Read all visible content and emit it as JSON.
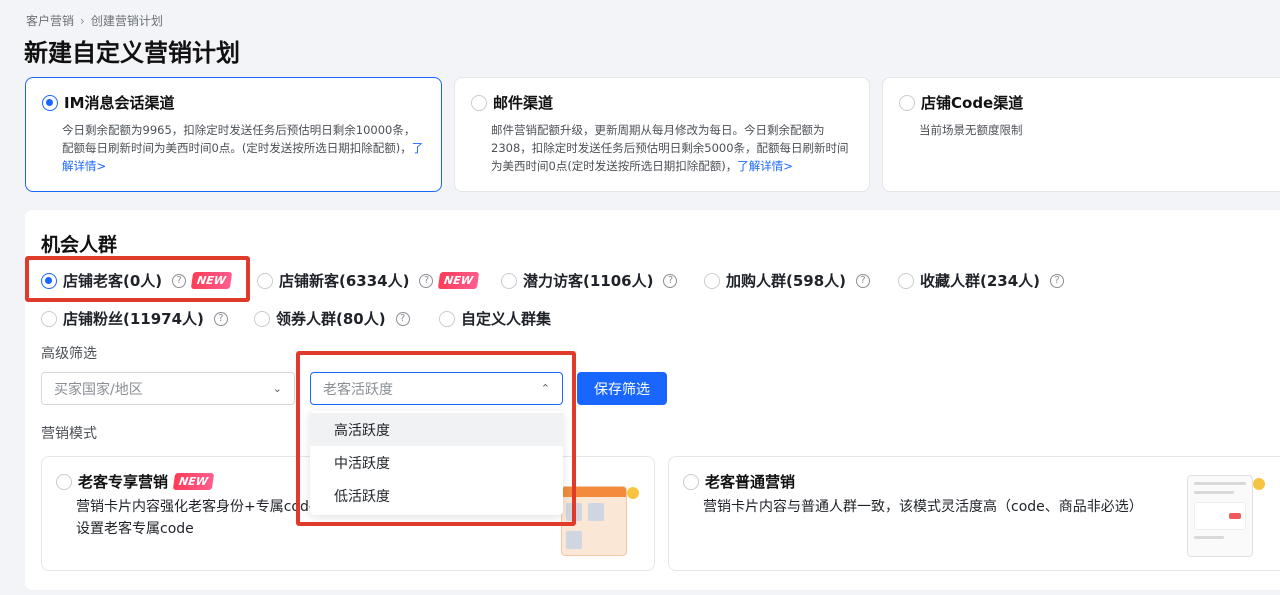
{
  "breadcrumb": {
    "root": "客户营销",
    "current": "创建营销计划"
  },
  "page_title": "新建自定义营销计划",
  "channels": [
    {
      "title": "IM消息会话渠道",
      "desc": "今日剩余配额为9965，扣除定时发送任务后预估明日剩余10000条，配额每日刷新时间为美西时间0点。(定时发送按所选日期扣除配额)，",
      "link": "了解详情>",
      "selected": true
    },
    {
      "title": "邮件渠道",
      "desc": "邮件营销配额升级，更新周期从每月修改为每日。今日剩余配额为2308，扣除定时发送任务后预估明日剩余5000条，配额每日刷新时间为美西时间0点(定时发送按所选日期扣除配额)，",
      "link": "了解详情>",
      "selected": false
    },
    {
      "title": "店铺Code渠道",
      "desc": "当前场景无额度限制",
      "selected": false
    }
  ],
  "audience": {
    "title": "机会人群",
    "items": [
      {
        "label": "店铺老客(0人)",
        "help": "?",
        "badge": "NEW",
        "selected": true
      },
      {
        "label": "店铺新客(6334人)",
        "help": "?",
        "badge": "NEW",
        "selected": false
      },
      {
        "label": "潜力访客(1106人)",
        "help": "?",
        "selected": false
      },
      {
        "label": "加购人群(598人)",
        "help": "?",
        "selected": false
      },
      {
        "label": "收藏人群(234人)",
        "help": "?",
        "selected": false
      },
      {
        "label": "店铺粉丝(11974人)",
        "help": "?",
        "selected": false
      },
      {
        "label": "领券人群(80人)",
        "help": "?",
        "selected": false
      },
      {
        "label": "自定义人群集",
        "selected": false
      }
    ]
  },
  "filter": {
    "label": "高级筛选",
    "country_placeholder": "买家国家/地区",
    "activity_placeholder": "老客活跃度",
    "save_label": "保存筛选",
    "activity_options": [
      "高活跃度",
      "中活跃度",
      "低活跃度"
    ]
  },
  "mode": {
    "label": "营销模式",
    "cards": [
      {
        "title": "老客专享营销",
        "badge": "NEW",
        "desc_line1": "营销卡片内容强化老客身份+专属code",
        "desc_line2": "设置老客专属code"
      },
      {
        "title": "老客普通营销",
        "desc_line1": "营销卡片内容与普通人群一致，该模式灵活度高（code、商品非必选）"
      }
    ]
  },
  "icons": {
    "breadcrumb_sep": "chevron-right-icon",
    "help": "question-circle-icon",
    "dropdown": "chevron-down-icon",
    "dropdown_open": "chevron-up-icon"
  },
  "colors": {
    "primary": "#1966ff",
    "highlight_box": "#e03a2a",
    "new_badge": "#ff3d57"
  }
}
